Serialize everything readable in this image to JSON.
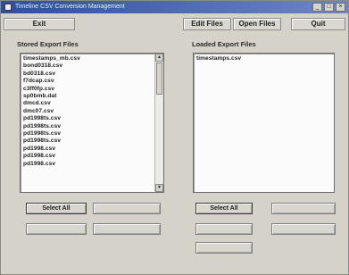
{
  "window": {
    "title": "Timeline CSV Conversion Management"
  },
  "toolbar": {
    "exit_label": "Exit",
    "edit_files_label": "Edit Files",
    "open_files_label": "Open Files",
    "quit_label": "Quit"
  },
  "left_panel": {
    "title": "Stored Export Files",
    "items": [
      "timestamps_mb.csv",
      "bond0318.csv",
      "bd0318.csv",
      "f7dcap.csv",
      "c3ff0fp.csv",
      "sp0bmb.dat",
      "dmcd.csv",
      "dmc07.csv",
      "pd1998ts.csv",
      "pd1998ts.csv",
      "pd1998ts.csv",
      "pd1998ts.csv",
      "pd1998.csv",
      "pd1998.csv",
      "pd1998.csv"
    ],
    "select_all_label": "Select All"
  },
  "right_panel": {
    "title": "Loaded Export Files",
    "items": [
      "timestamps.csv"
    ],
    "select_all_label": "Select All"
  }
}
